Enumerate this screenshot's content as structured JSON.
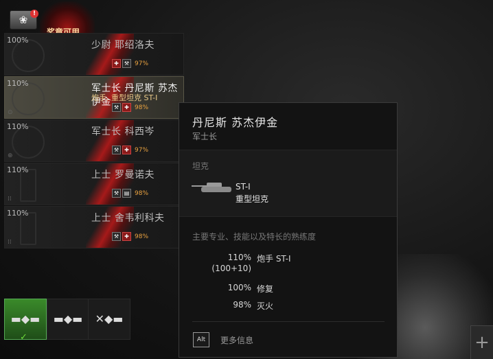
{
  "medal": {
    "alert": "!",
    "banner": "奖章可用"
  },
  "crew": [
    {
      "pct": "100%",
      "name": "少尉 耶绍洛夫",
      "sub": "",
      "skills": [
        "red",
        "dark"
      ],
      "skill_pct": "97%"
    },
    {
      "pct": "110%",
      "name": "军士长 丹尼斯 苏杰伊金",
      "sub": "炮手, 重型坦克 ST-I",
      "skills": [
        "dark",
        "red"
      ],
      "skill_pct": "98%"
    },
    {
      "pct": "110%",
      "name": "军士长 科西岑",
      "sub": "",
      "skills": [
        "dark",
        "red"
      ],
      "skill_pct": "97%"
    },
    {
      "pct": "110%",
      "name": "上士 罗曼诺夫",
      "sub": "",
      "skills": [
        "dark",
        "dark"
      ],
      "skill_pct": "98%"
    },
    {
      "pct": "110%",
      "name": "上士 舍韦利科夫",
      "sub": "",
      "skills": [
        "dark",
        "red"
      ],
      "skill_pct": "98%"
    }
  ],
  "tooltip": {
    "name": "丹尼斯 苏杰伊金",
    "rank": "军士长",
    "tank_section": "坦克",
    "tank_name": "ST-I",
    "tank_type": "重型坦克",
    "skills_section": "主要专业、技能以及特长的熟练度",
    "skills": [
      {
        "value": "110%",
        "value2": "(100+10)",
        "name": "炮手 ST-I"
      },
      {
        "value": "100%",
        "value2": "",
        "name": "修复"
      },
      {
        "value": "98%",
        "value2": "",
        "name": "灭火"
      }
    ],
    "alt_key": "Alt",
    "more_info": "更多信息"
  },
  "plus_label": "+",
  "vehicle_icons": [
    "tank-icon",
    "tank-icon",
    "tank-crossed-icon"
  ]
}
